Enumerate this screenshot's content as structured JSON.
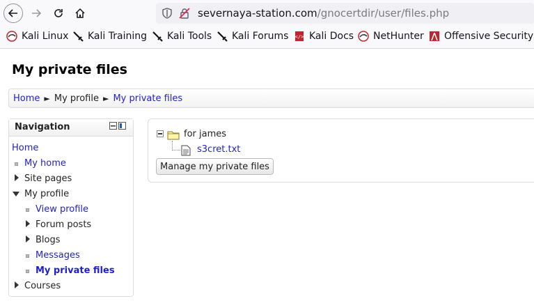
{
  "browser": {
    "url_host": "severnaya-station.com",
    "url_path": "/gnocertdir/user/files.php"
  },
  "bookmarks": [
    {
      "label": "Kali Linux",
      "icon": "kali-dragon-icon"
    },
    {
      "label": "Kali Training",
      "icon": "kali-sword-icon"
    },
    {
      "label": "Kali Tools",
      "icon": "kali-sword-icon"
    },
    {
      "label": "Kali Forums",
      "icon": "kali-sword-icon"
    },
    {
      "label": "Kali Docs",
      "icon": "kali-docs-icon"
    },
    {
      "label": "NetHunter",
      "icon": "kali-dragon-icon"
    },
    {
      "label": "Offensive Security",
      "icon": "offsec-icon"
    }
  ],
  "page": {
    "title": "My private files"
  },
  "breadcrumb": {
    "home": "Home",
    "profile": "My profile",
    "current": "My private files",
    "separator": "►"
  },
  "navigation": {
    "title": "Navigation",
    "home": "Home",
    "my_home": "My home",
    "site_pages": "Site pages",
    "my_profile": "My profile",
    "view_profile": "View profile",
    "forum_posts": "Forum posts",
    "blogs": "Blogs",
    "messages": "Messages",
    "my_private_files": "My private files",
    "courses": "Courses"
  },
  "files": {
    "folder_name": "for james",
    "file_name": "s3cret.txt",
    "manage_button": "Manage my private files"
  },
  "colors": {
    "link": "#1f1fcc",
    "kali_red": "#c0262d"
  }
}
